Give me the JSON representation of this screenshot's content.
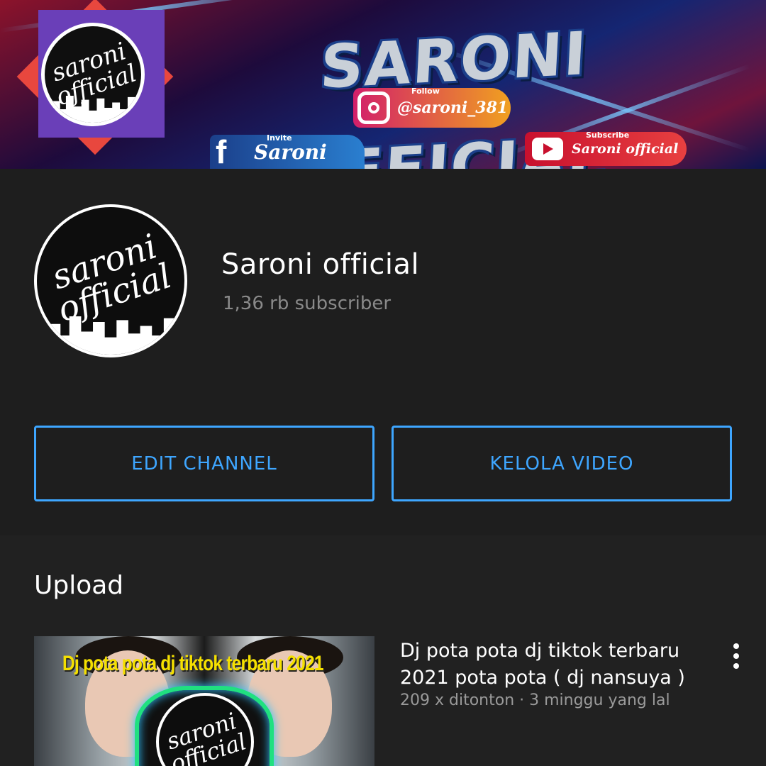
{
  "banner": {
    "title": "SARONI OFFICIAL",
    "logo_text_line1": "saroni",
    "logo_text_line2": "official",
    "instagram": {
      "caption": "Follow",
      "handle": "@saroni_381"
    },
    "facebook": {
      "caption": "Invite",
      "name": "Saroni"
    },
    "youtube": {
      "caption": "Subscribe",
      "name": "Saroni official"
    }
  },
  "channel": {
    "name": "Saroni official",
    "subscribers": "1,36 rb subscriber",
    "avatar_text_line1": "saroni",
    "avatar_text_line2": "official",
    "edit_button": "EDIT CHANNEL",
    "manage_button": "KELOLA VIDEO"
  },
  "uploads": {
    "title": "Upload",
    "videos": [
      {
        "thumbnail_text": "Dj pota pota dj tiktok terbaru 2021",
        "thumbnail_logo_line1": "saroni",
        "thumbnail_logo_line2": "official",
        "title": "Dj pota pota dj tiktok terbaru 2021 pota pota ( dj nansuya )",
        "meta": "209 x ditonton  ·  3 minggu yang lal"
      }
    ]
  },
  "colors": {
    "background": "#212121",
    "header_background": "#1e1e1e",
    "accent_blue": "#3ea6ff",
    "secondary_text": "#8a8a8a"
  },
  "icons": {
    "instagram": "instagram-icon",
    "facebook": "facebook-icon",
    "youtube": "youtube-play-icon",
    "more": "more-vertical-icon"
  }
}
